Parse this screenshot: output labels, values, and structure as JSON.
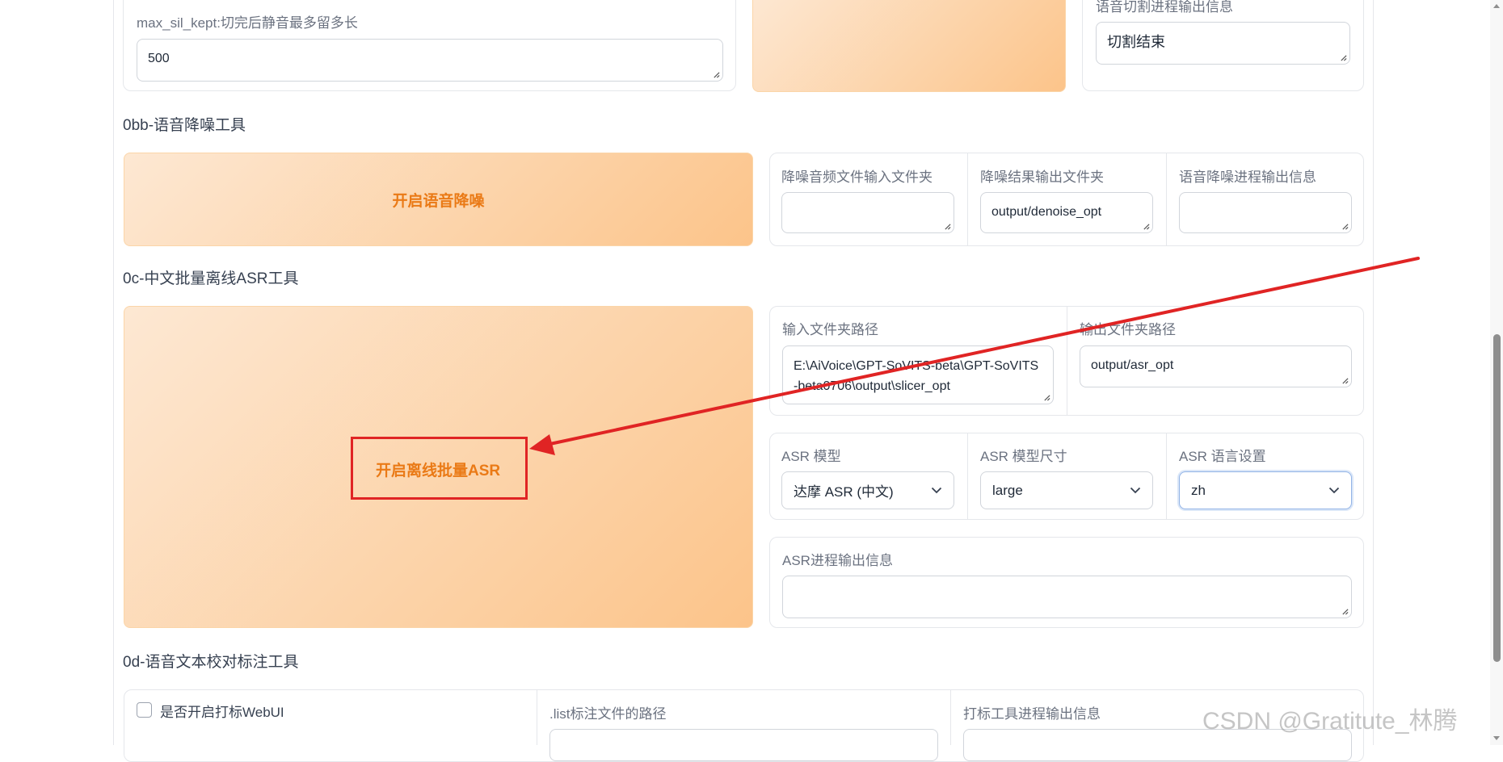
{
  "slicer": {
    "max_sil_label": "max_sil_kept:切完后静音最多留多长",
    "max_sil_value": "500",
    "info_label": "语音切割进程输出信息",
    "info_value": "切割结束"
  },
  "denoise": {
    "section_title": "0bb-语音降噪工具",
    "button_label": "开启语音降噪",
    "input_label": "降噪音频文件输入文件夹",
    "input_value": "",
    "output_label": "降噪结果输出文件夹",
    "output_value": "output/denoise_opt",
    "info_label": "语音降噪进程输出信息",
    "info_value": ""
  },
  "asr": {
    "section_title": "0c-中文批量离线ASR工具",
    "button_label": "开启离线批量ASR",
    "input_path_label": "输入文件夹路径",
    "input_path_value": "E:\\AiVoice\\GPT-SoVITS-beta\\GPT-SoVITS-beta0706\\output\\slicer_opt",
    "output_path_label": "输出文件夹路径",
    "output_path_value": "output/asr_opt",
    "model_label": "ASR 模型",
    "model_value": "达摩 ASR (中文)",
    "size_label": "ASR 模型尺寸",
    "size_value": "large",
    "lang_label": "ASR 语言设置",
    "lang_value": "zh",
    "info_label": "ASR进程输出信息",
    "info_value": ""
  },
  "proofread": {
    "section_title": "0d-语音文本校对标注工具",
    "checkbox_label": "是否开启打标WebUI",
    "list_path_label": ".list标注文件的路径",
    "info_label": "打标工具进程输出信息"
  },
  "watermark": "CSDN @Gratitute_林腾",
  "colors": {
    "accent_orange": "#ea7a16",
    "annotation_red": "#e02424"
  }
}
